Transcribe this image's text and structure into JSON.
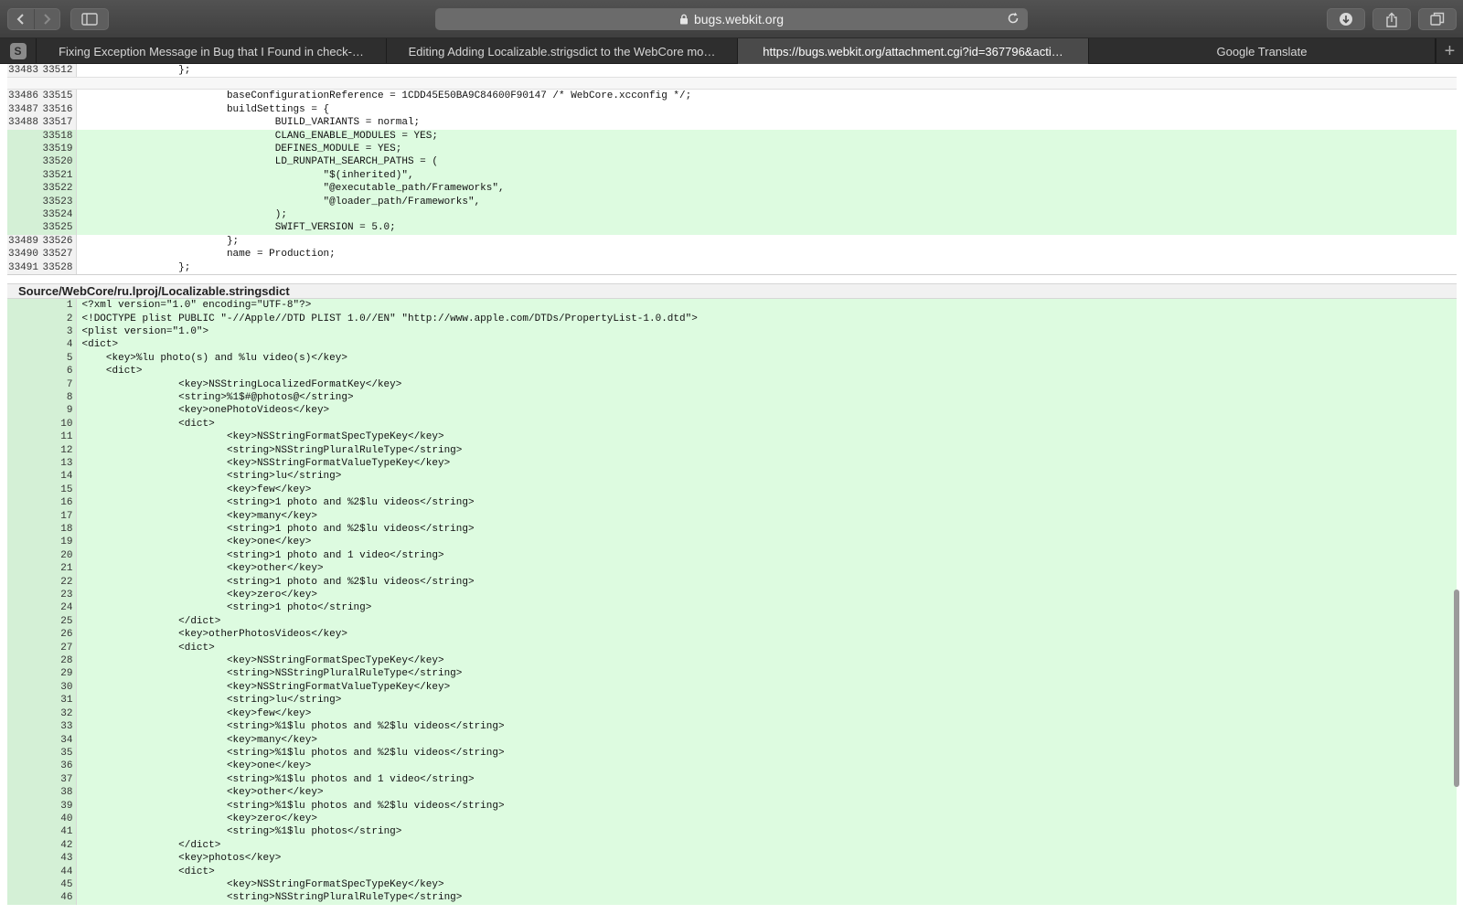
{
  "browser": {
    "url_display": "bugs.webkit.org",
    "pinned_tab_letter": "S",
    "tabs": [
      {
        "label": "Fixing Exception Message in Bug that I Found in check-…",
        "active": false
      },
      {
        "label": "Editing Adding Localizable.strigsdict to the WebCore mo…",
        "active": false
      },
      {
        "label": "https://bugs.webkit.org/attachment.cgi?id=367796&acti…",
        "active": true
      },
      {
        "label": "Google Translate",
        "active": false
      }
    ],
    "new_tab_label": "+",
    "icons": {
      "back": "chevron-left-icon",
      "forward": "chevron-right-icon",
      "sidebar": "sidebar-icon",
      "lock": "lock-icon",
      "reload": "reload-icon",
      "downloads": "download-icon",
      "share": "share-icon",
      "tabs": "tab-overview-icon"
    }
  },
  "diff_top": {
    "first_row": {
      "old": "33483",
      "new": "33512",
      "code": "\t\t};"
    },
    "rows": [
      {
        "type": "ctx",
        "old": "33486",
        "new": "33515",
        "code": "\t\t\tbaseConfigurationReference = 1CDD45E50BA9C84600F90147 /* WebCore.xcconfig */;"
      },
      {
        "type": "ctx",
        "old": "33487",
        "new": "33516",
        "code": "\t\t\tbuildSettings = {"
      },
      {
        "type": "ctx",
        "old": "33488",
        "new": "33517",
        "code": "\t\t\t\tBUILD_VARIANTS = normal;"
      },
      {
        "type": "add",
        "old": "",
        "new": "33518",
        "code": "\t\t\t\tCLANG_ENABLE_MODULES = YES;"
      },
      {
        "type": "add",
        "old": "",
        "new": "33519",
        "code": "\t\t\t\tDEFINES_MODULE = YES;"
      },
      {
        "type": "add",
        "old": "",
        "new": "33520",
        "code": "\t\t\t\tLD_RUNPATH_SEARCH_PATHS = ("
      },
      {
        "type": "add",
        "old": "",
        "new": "33521",
        "code": "\t\t\t\t\t\"$(inherited)\","
      },
      {
        "type": "add",
        "old": "",
        "new": "33522",
        "code": "\t\t\t\t\t\"@executable_path/Frameworks\","
      },
      {
        "type": "add",
        "old": "",
        "new": "33523",
        "code": "\t\t\t\t\t\"@loader_path/Frameworks\","
      },
      {
        "type": "add",
        "old": "",
        "new": "33524",
        "code": "\t\t\t\t);"
      },
      {
        "type": "add",
        "old": "",
        "new": "33525",
        "code": "\t\t\t\tSWIFT_VERSION = 5.0;"
      },
      {
        "type": "ctx",
        "old": "33489",
        "new": "33526",
        "code": "\t\t\t};"
      },
      {
        "type": "ctx",
        "old": "33490",
        "new": "33527",
        "code": "\t\t\tname = Production;"
      },
      {
        "type": "ctx",
        "old": "33491",
        "new": "33528",
        "code": "\t\t};"
      }
    ]
  },
  "file2": {
    "path": "Source/WebCore/ru.lproj/Localizable.stringsdict",
    "rows": [
      {
        "n": "1",
        "code": "<?xml version=\"1.0\" encoding=\"UTF-8\"?>"
      },
      {
        "n": "2",
        "code": "<!DOCTYPE plist PUBLIC \"-//Apple//DTD PLIST 1.0//EN\" \"http://www.apple.com/DTDs/PropertyList-1.0.dtd\">"
      },
      {
        "n": "3",
        "code": "<plist version=\"1.0\">"
      },
      {
        "n": "4",
        "code": "<dict>"
      },
      {
        "n": "5",
        "code": "    <key>%lu photo(s) and %lu video(s)</key>"
      },
      {
        "n": "6",
        "code": "    <dict>"
      },
      {
        "n": "7",
        "code": "\t\t<key>NSStringLocalizedFormatKey</key>"
      },
      {
        "n": "8",
        "code": "\t\t<string>%1$#@photos@</string>"
      },
      {
        "n": "9",
        "code": "\t\t<key>onePhotoVideos</key>"
      },
      {
        "n": "10",
        "code": "\t\t<dict>"
      },
      {
        "n": "11",
        "code": "\t\t\t<key>NSStringFormatSpecTypeKey</key>"
      },
      {
        "n": "12",
        "code": "\t\t\t<string>NSStringPluralRuleType</string>"
      },
      {
        "n": "13",
        "code": "\t\t\t<key>NSStringFormatValueTypeKey</key>"
      },
      {
        "n": "14",
        "code": "\t\t\t<string>lu</string>"
      },
      {
        "n": "15",
        "code": "\t\t\t<key>few</key>"
      },
      {
        "n": "16",
        "code": "\t\t\t<string>1 photo and %2$lu videos</string>"
      },
      {
        "n": "17",
        "code": "\t\t\t<key>many</key>"
      },
      {
        "n": "18",
        "code": "\t\t\t<string>1 photo and %2$lu videos</string>"
      },
      {
        "n": "19",
        "code": "\t\t\t<key>one</key>"
      },
      {
        "n": "20",
        "code": "\t\t\t<string>1 photo and 1 video</string>"
      },
      {
        "n": "21",
        "code": "\t\t\t<key>other</key>"
      },
      {
        "n": "22",
        "code": "\t\t\t<string>1 photo and %2$lu videos</string>"
      },
      {
        "n": "23",
        "code": "\t\t\t<key>zero</key>"
      },
      {
        "n": "24",
        "code": "\t\t\t<string>1 photo</string>"
      },
      {
        "n": "25",
        "code": "\t\t</dict>"
      },
      {
        "n": "26",
        "code": "\t\t<key>otherPhotosVideos</key>"
      },
      {
        "n": "27",
        "code": "\t\t<dict>"
      },
      {
        "n": "28",
        "code": "\t\t\t<key>NSStringFormatSpecTypeKey</key>"
      },
      {
        "n": "29",
        "code": "\t\t\t<string>NSStringPluralRuleType</string>"
      },
      {
        "n": "30",
        "code": "\t\t\t<key>NSStringFormatValueTypeKey</key>"
      },
      {
        "n": "31",
        "code": "\t\t\t<string>lu</string>"
      },
      {
        "n": "32",
        "code": "\t\t\t<key>few</key>"
      },
      {
        "n": "33",
        "code": "\t\t\t<string>%1$lu photos and %2$lu videos</string>"
      },
      {
        "n": "34",
        "code": "\t\t\t<key>many</key>"
      },
      {
        "n": "35",
        "code": "\t\t\t<string>%1$lu photos and %2$lu videos</string>"
      },
      {
        "n": "36",
        "code": "\t\t\t<key>one</key>"
      },
      {
        "n": "37",
        "code": "\t\t\t<string>%1$lu photos and 1 video</string>"
      },
      {
        "n": "38",
        "code": "\t\t\t<key>other</key>"
      },
      {
        "n": "39",
        "code": "\t\t\t<string>%1$lu photos and %2$lu videos</string>"
      },
      {
        "n": "40",
        "code": "\t\t\t<key>zero</key>"
      },
      {
        "n": "41",
        "code": "\t\t\t<string>%1$lu photos</string>"
      },
      {
        "n": "42",
        "code": "\t\t</dict>"
      },
      {
        "n": "43",
        "code": "\t\t<key>photos</key>"
      },
      {
        "n": "44",
        "code": "\t\t<dict>"
      },
      {
        "n": "45",
        "code": "\t\t\t<key>NSStringFormatSpecTypeKey</key>"
      },
      {
        "n": "46",
        "code": "\t\t\t<string>NSStringPluralRuleType</string>"
      }
    ]
  },
  "colors": {
    "added_background": "#ddfbe0",
    "added_gutter": "#d4f0d6",
    "chrome_dark": "#3f3f3f"
  }
}
